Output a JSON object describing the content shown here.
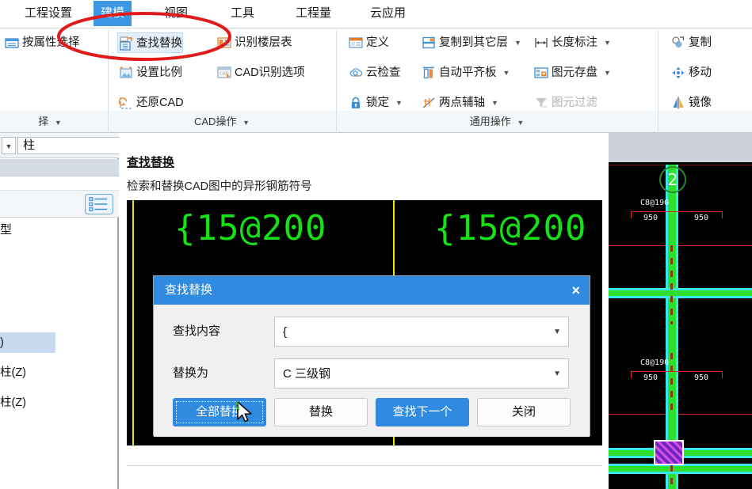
{
  "ribbon": {
    "tabs": [
      {
        "label": "工程设置",
        "active": false
      },
      {
        "label": "建模",
        "active": true
      },
      {
        "label": "视图",
        "active": false
      },
      {
        "label": "工具",
        "active": false
      },
      {
        "label": "工程量",
        "active": false
      },
      {
        "label": "云应用",
        "active": false
      }
    ],
    "groups": [
      {
        "label": "择",
        "caret": "▾"
      },
      {
        "label": "CAD操作",
        "caret": "▾"
      },
      {
        "label": "通用操作",
        "caret": "▾"
      }
    ],
    "buttons": {
      "select_by_property": "按属性选择",
      "find_replace": "查找替换",
      "recognize_floor_table": "识别楼层表",
      "set_scale": "设置比例",
      "cad_recognize_options": "CAD识别选项",
      "restore_cad": "还原CAD",
      "define": "定义",
      "cloud_check": "云检查",
      "lock": "锁定",
      "copy_to_other_floor": "复制到其它层",
      "auto_align_slab": "自动平齐板",
      "two_point_aux_axis": "两点辅轴",
      "length_dimension": "长度标注",
      "element_save": "图元存盘",
      "element_filter": "图元过滤",
      "copy": "复制",
      "move": "移动",
      "mirror": "镜像"
    }
  },
  "sidebar": {
    "combo_value": "柱",
    "type_label": "型",
    "rows": [
      {
        "label": ")",
        "highlighted": true
      },
      {
        "label": "柱(Z)",
        "highlighted": false
      },
      {
        "label": "柱(Z)",
        "highlighted": false
      }
    ]
  },
  "panel": {
    "title": "查找替换",
    "subtitle": "检索和替换CAD图中的异形钢筋符号",
    "cad_preview_texts": [
      "{15@200",
      "{15@200"
    ]
  },
  "dialog": {
    "title": "查找替换",
    "close_icon": "×",
    "fields": [
      {
        "label": "查找内容",
        "value": "{",
        "placeholder": ""
      },
      {
        "label": "替换为",
        "value": "C 三级钢",
        "placeholder": ""
      }
    ],
    "buttons": [
      {
        "label": "全部替换",
        "style": "primary",
        "focused": true
      },
      {
        "label": "替换",
        "style": "normal",
        "focused": false
      },
      {
        "label": "查找下一个",
        "style": "primary",
        "focused": false
      },
      {
        "label": "关闭",
        "style": "normal",
        "focused": false
      }
    ]
  },
  "cad_viewport": {
    "axis_label": "2",
    "annotations": [
      {
        "rebar": "C8@190",
        "dim_left": "950",
        "dim_right": "950"
      },
      {
        "rebar": "C8@190",
        "dim_left": "950",
        "dim_right": "950"
      }
    ]
  },
  "colors": {
    "accent_blue": "#2f8ae0",
    "tab_active": "#3b97e3",
    "annotation_red": "#e01b1b",
    "cad_green": "#2ee02e",
    "cad_cyan": "#36e8e8",
    "cad_text_green": "#16e016",
    "cad_yellow": "#e8e800",
    "column_purple": "#6d26c4"
  }
}
